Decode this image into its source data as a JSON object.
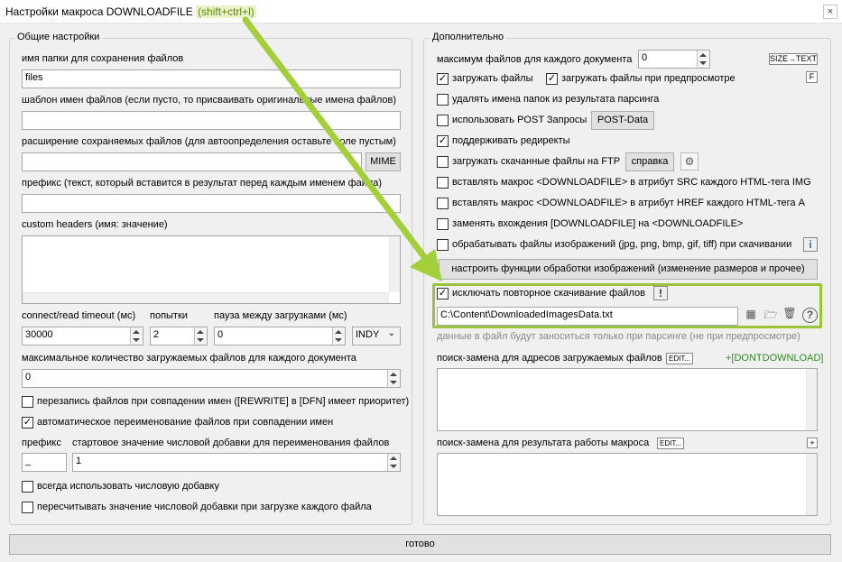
{
  "window": {
    "title": "Настройки макроса DOWNLOADFILE",
    "shortcut": "(shift+ctrl+l)",
    "close": "×"
  },
  "left": {
    "legend": "Общие настройки",
    "folder_label": "имя папки для сохранения файлов",
    "folder_value": "files",
    "template_label": "шаблон имен файлов (если пусто, то присваивать оригинальные имена файлов)",
    "template_value": "",
    "ext_label": "расширение сохраняемых файлов (для автоопределения оставьте поле пустым)",
    "ext_value": "",
    "mime_button": "MIME",
    "prefix_label": "префикс (текст, который вставится в результат перед каждым именем файла)",
    "prefix_value": "",
    "headers_label": "custom headers (имя: значение)",
    "timeout_label": "connect/read timeout (мс)",
    "timeout_value": "30000",
    "attempts_label": "попытки",
    "attempts_value": "2",
    "pause_label": "пауза между загрузками (мс)",
    "pause_value": "0",
    "engine_value": "INDY",
    "max_label": "максимальное количество загружаемых файлов для каждого документа",
    "max_value": "0",
    "overwrite_label": "перезапись файлов при совпадении имен ([REWRITE] в [DFN] имеет приоритет)",
    "overwrite_checked": false,
    "autorename_label": "автоматическое переименование файлов при совпадении имен",
    "autorename_checked": true,
    "prefix2_label": "префикс",
    "prefix2_value": "_",
    "start_label": "стартовое значение числовой добавки для переименования файлов",
    "start_value": "1",
    "always_num_label": "всегда использовать числовую добавку",
    "always_num_checked": false,
    "recount_label": "пересчитывать значение числовой добавки при загрузке каждого файла",
    "recount_checked": false
  },
  "right": {
    "legend": "Дополнительно",
    "maxfiles_label": "максимум файлов для каждого документа",
    "maxfiles_value": "0",
    "size_text_btn": "SIZE→TEXT",
    "load_files_label": "загружать файлы",
    "load_files_checked": true,
    "load_preview_label": "загружать файлы при предпросмотре",
    "load_preview_checked": true,
    "f_btn": "F",
    "del_folders_label": "удалять имена папок из результата парсинга",
    "del_folders_checked": false,
    "post_label": "использовать POST Запросы",
    "post_checked": false,
    "post_btn": "POST-Data",
    "redirect_label": "поддерживать редиректы",
    "redirect_checked": true,
    "ftp_label": "загружать скачанные файлы на FTP",
    "ftp_checked": false,
    "help_btn": "справка",
    "src_label": "вставлять макрос <DOWNLOADFILE> в атрибут SRC каждого HTML-тега IMG",
    "src_checked": false,
    "href_label": "вставлять макрос <DOWNLOADFILE> в атрибут HREF каждого HTML-тега A",
    "href_checked": false,
    "replace_label": "заменять вхождения [DOWNLOADFILE] на <DOWNLOADFILE>",
    "replace_checked": false,
    "images_label": "обрабатывать файлы изображений (jpg, png, bmp, gif, tiff) при скачивании",
    "images_checked": false,
    "images_btn": "настроить функции обработки изображений (изменение размеров и прочее)",
    "exclude_label": "исключать повторное скачивание файлов",
    "exclude_checked": true,
    "info_glyph": "!",
    "path_value": "C:\\Content\\DownloadedImagesData.txt",
    "path_note": "данные в файл будут заноситься только при парсинге (не при предпросмотре)",
    "search_urls_label": "поиск-замена для адресов загружаемых файлов",
    "edit1": "EDIT...",
    "dontdownload": "+[DONTDOWNLOAD]",
    "search_result_label": "поиск-замена для результата работы макроса",
    "edit2": "EDIT...",
    "plus": "+"
  },
  "footer": {
    "ok_button": "готово"
  },
  "colors": {
    "highlight": "#9ac43a",
    "arrow": "#a2cf3a",
    "green_text": "#2e8b22"
  }
}
